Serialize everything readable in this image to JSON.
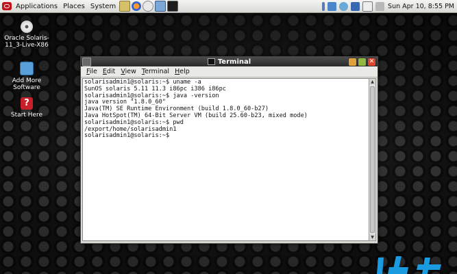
{
  "top_panel": {
    "menus": [
      "Applications",
      "Places",
      "System"
    ],
    "clock": "Sun Apr 10,  8:55 PM"
  },
  "desktop_icons": [
    {
      "label": "Oracle Solaris-11_3-Live-X86",
      "icon": "cd-icon"
    },
    {
      "label": "Add More Software",
      "icon": "package-add-icon"
    },
    {
      "label": "Start Here",
      "icon": "help-icon"
    }
  ],
  "terminal": {
    "title": "Terminal",
    "menu": [
      "File",
      "Edit",
      "View",
      "Terminal",
      "Help"
    ],
    "lines": [
      "solarisadmin1@solaris:~$ uname -a",
      "SunOS solaris 5.11 11.3 i86pc i386 i86pc",
      "solarisadmin1@solaris:~$ java -version",
      "java version \"1.8.0_60\"",
      "Java(TM) SE Runtime Environment (build 1.8.0_60-b27)",
      "Java HotSpot(TM) 64-Bit Server VM (build 25.60-b23, mixed mode)",
      "solarisadmin1@solaris:~$ pwd",
      "/export/home/solarisadmin1",
      "solarisadmin1@solaris:~$"
    ]
  },
  "colors": {
    "close": "#e0442a",
    "minimize": "#e0a13a",
    "maximize": "#8fb83c",
    "brand": "#1a9be0"
  }
}
